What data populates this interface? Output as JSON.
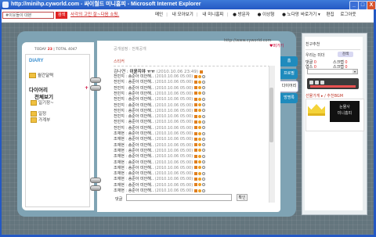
{
  "window": {
    "title": "http://minihp.cyworld.com - 싸이월드 미니홈피 - Microsoft Internet Explorer",
    "minimize": "_",
    "maximize": "□",
    "close": "X"
  },
  "toolbar": {
    "search_placeholder": "#이웃들이 대본",
    "search_button": "검색",
    "ad_text": "사각의 고민 잘~다음 쇼핑.",
    "links": [
      "메인",
      "내 모아보기",
      "내 미니홈피"
    ],
    "visitors": [
      "방문자",
      "이상형",
      "노다망"
    ],
    "right_links": [
      "바로가기 ▾",
      "편집",
      "로그아웃"
    ]
  },
  "diary": {
    "counter_today_label": "TODAY",
    "counter_today": "23",
    "counter_total_label": "TOTAL",
    "counter_total": "4047",
    "title": "DIARY",
    "items": [
      "월간달력"
    ],
    "category_head": "다이어리",
    "category_plus": "+",
    "category_all": "전체보기",
    "category_sub": "일기장~",
    "bottom_items": [
      "일정",
      "가계부"
    ]
  },
  "main": {
    "url": "http://www.cyworld.com",
    "share": "공개설정 : 전체공개",
    "share_link": "♥퍼가기",
    "section": "스티커",
    "first_comment": {
      "who": "김나연",
      "msg": "이윤지야 ㅠㅠ",
      "date": "(2010.10.06 23:49)"
    },
    "comments": [
      {
        "who": "전민지",
        "msg": "송준아 미안해..",
        "date": "(2010.10.06 05:00)"
      },
      {
        "who": "전민지",
        "msg": "송준아 미안해..",
        "date": "(2010.10.06 05:00)"
      },
      {
        "who": "전민지",
        "msg": "송준아 미안해..",
        "date": "(2010.10.06 05:00)"
      },
      {
        "who": "전민지",
        "msg": "송준아 미안해..",
        "date": "(2010.10.06 05:00)"
      },
      {
        "who": "전민지",
        "msg": "송준아 미안해..",
        "date": "(2010.10.06 05:00)"
      },
      {
        "who": "전민지",
        "msg": "송준아 미안해..",
        "date": "(2010.10.06 05:00)"
      },
      {
        "who": "전민지",
        "msg": "송준아 미안해..",
        "date": "(2010.10.06 05:00)"
      },
      {
        "who": "전민지",
        "msg": "송준아 미안해..",
        "date": "(2010.10.06 05:00)"
      },
      {
        "who": "전민지",
        "msg": "송준아 미안해..",
        "date": "(2010.10.06 05:00)"
      },
      {
        "who": "전민지",
        "msg": "송준아 미안해..",
        "date": "(2010.10.06 05:00)"
      },
      {
        "who": "조재현",
        "msg": "송준아 미안해..",
        "date": "(2010.10.06 05:00)"
      },
      {
        "who": "조재현",
        "msg": "송준아 미안해..",
        "date": "(2010.10.06 05:00)"
      },
      {
        "who": "조재현",
        "msg": "송준아 미안해..",
        "date": "(2010.10.06 05:00)"
      },
      {
        "who": "조재현",
        "msg": "송준아 미안해..",
        "date": "(2010.10.06 05:00)"
      },
      {
        "who": "조재현",
        "msg": "송준아 미안해..",
        "date": "(2010.10.06 05:00)"
      },
      {
        "who": "조재현",
        "msg": "송준아 미안해..",
        "date": "(2010.10.06 05:00)"
      },
      {
        "who": "조재현",
        "msg": "송준아 미안해..",
        "date": "(2010.10.06 05:00)"
      },
      {
        "who": "조재현",
        "msg": "송준아 미안해..",
        "date": "(2010.10.06 05:00)"
      },
      {
        "who": "조재현",
        "msg": "송준아 미안해..",
        "date": "(2010.10.06 05:00)"
      },
      {
        "who": "조재현",
        "msg": "송준아 미안해..",
        "date": "(2010.10.06 05:00)"
      },
      {
        "who": "조재현",
        "msg": "송준아 미안해..",
        "date": "(2010.10.06 05:00)"
      }
    ],
    "reply_label": "댓글",
    "reply_button": "확인"
  },
  "tabs": [
    "홈",
    "프로필",
    "다이어리",
    "방명록"
  ],
  "side": {
    "title": "친구추천",
    "search_label": "우리는 미더",
    "badge": "검색",
    "stats": [
      "댓글 ",
      "0",
      "스크랩 ",
      "0",
      "엽스 ",
      "0",
      "스크랩 ",
      "0"
    ],
    "bgm": "선물가게 ▸ / 추천BGM",
    "dark_text_1": "눈물사",
    "dark_text_2": "미니홈피"
  },
  "colors": {
    "accent": "#e02424",
    "tab_blue": "#1f8bbd",
    "diary_blue": "#3a8fd0",
    "binder": "#7fa3b4",
    "desk": "#64757d"
  }
}
